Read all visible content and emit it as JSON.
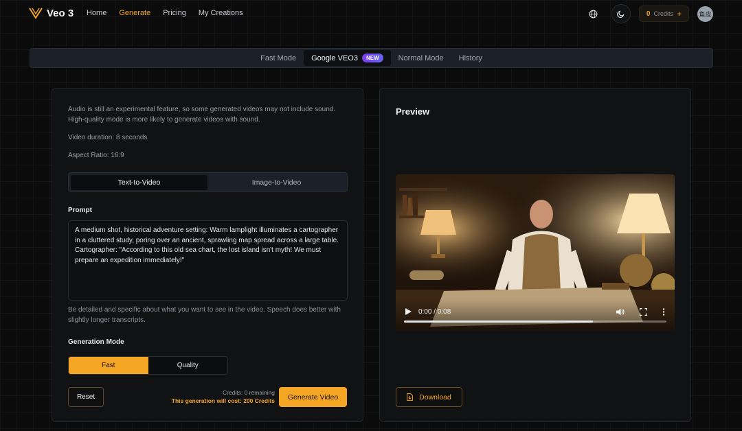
{
  "header": {
    "logo_text": "Veo 3",
    "nav": [
      {
        "label": "Home"
      },
      {
        "label": "Generate"
      },
      {
        "label": "Pricing"
      },
      {
        "label": "My Creations"
      }
    ],
    "credits_count": "0",
    "credits_label": "Credits",
    "credits_plus": "+",
    "avatar_text": "鱼皮"
  },
  "modes": {
    "tabs": [
      {
        "label": "Fast Mode"
      },
      {
        "label": "Google VEO3"
      },
      {
        "label": "Normal Mode"
      },
      {
        "label": "History"
      }
    ],
    "badge": "NEW"
  },
  "left_panel": {
    "audio_note": "Audio is still an experimental feature, so some generated videos may not include sound. High-quality mode is more likely to generate videos with sound.",
    "duration": "Video duration: 8 seconds",
    "aspect": "Aspect Ratio: 16:9",
    "input_tabs": [
      "Text-to-Video",
      "Image-to-Video"
    ],
    "prompt_label": "Prompt",
    "prompt_value": "A medium shot, historical adventure setting: Warm lamplight illuminates a cartographer in a cluttered study, poring over an ancient, sprawling map spread across a large table. Cartographer: \"According to this old sea chart, the lost island isn't myth! We must prepare an expedition immediately!\"",
    "hint": "Be detailed and specific about what you want to see in the video. Speech does better with slightly longer transcripts.",
    "mode_label": "Generation Mode",
    "mode_options": [
      "Fast",
      "Quality"
    ],
    "reset_label": "Reset",
    "credits_remaining": "Credits: 0 remaining",
    "cost_text": "This generation will cost: 200 Credits",
    "generate_label": "Generate Video"
  },
  "right_panel": {
    "title": "Preview",
    "video": {
      "time": "0:00 / 0:08",
      "progress": 0.72
    },
    "download_label": "Download"
  },
  "colors": {
    "accent": "#f5a524",
    "badge": "#6d5ce8"
  }
}
